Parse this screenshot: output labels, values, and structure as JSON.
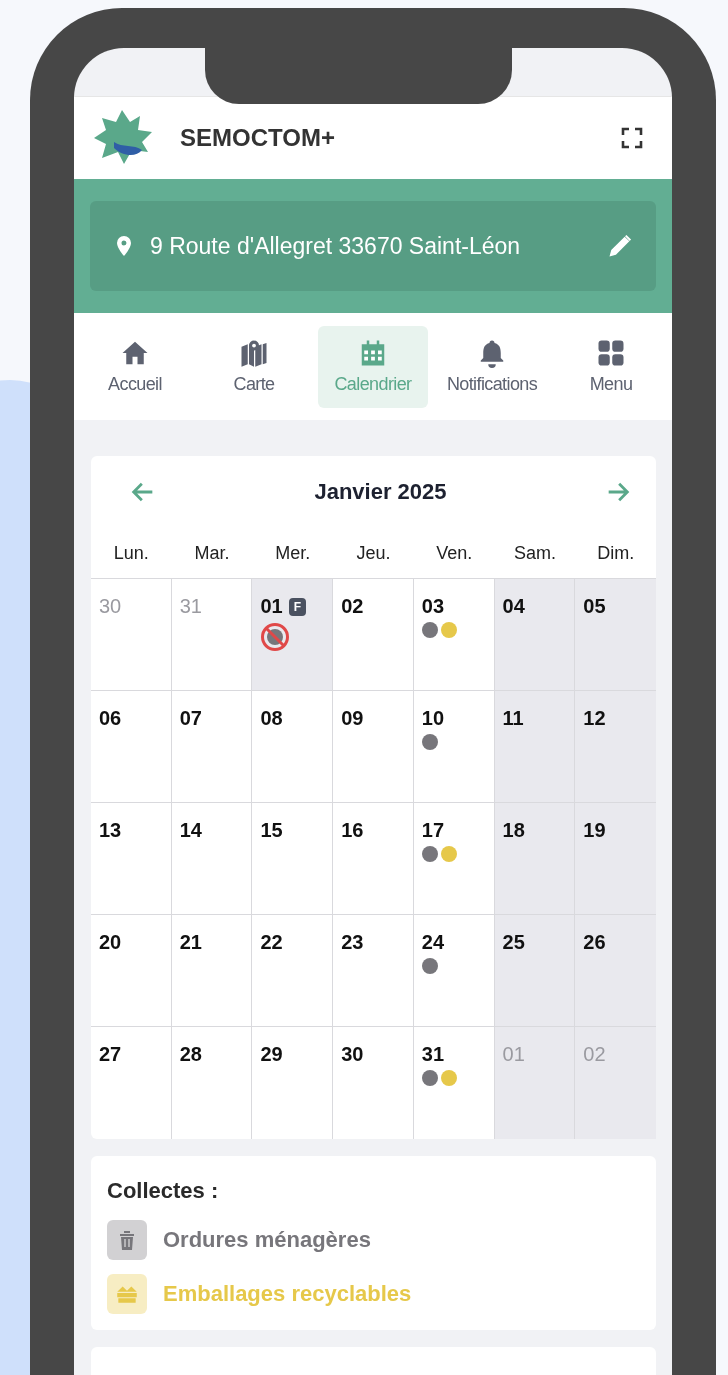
{
  "app_bar": {
    "title": "SEMOCTOM+"
  },
  "address": {
    "text": "9 Route d'Allegret 33670 Saint-Léon"
  },
  "nav": [
    {
      "label": "Accueil",
      "selected": false
    },
    {
      "label": "Carte",
      "selected": false
    },
    {
      "label": "Calendrier",
      "selected": true
    },
    {
      "label": "Notifications",
      "selected": false
    },
    {
      "label": "Menu",
      "selected": false
    }
  ],
  "calendar": {
    "month": "Janvier 2025",
    "weekdays": [
      {
        "label": "Lun.",
        "weekend": false
      },
      {
        "label": "Mar.",
        "weekend": false
      },
      {
        "label": "Mer.",
        "weekend": false
      },
      {
        "label": "Jeu.",
        "weekend": false
      },
      {
        "label": "Ven.",
        "weekend": false
      },
      {
        "label": "Sam.",
        "weekend": true
      },
      {
        "label": "Dim.",
        "weekend": true
      }
    ],
    "weeks": [
      [
        {
          "day": "30",
          "outside": true
        },
        {
          "day": "31",
          "outside": true
        },
        {
          "day": "01",
          "holiday": true,
          "badge": "F",
          "dots": [
            {
              "color": "#77767b",
              "cancelled": true
            }
          ]
        },
        {
          "day": "02"
        },
        {
          "day": "03",
          "dots": [
            {
              "color": "#77767b"
            },
            {
              "color": "#e6c84a"
            }
          ]
        },
        {
          "day": "04"
        },
        {
          "day": "05"
        }
      ],
      [
        {
          "day": "06"
        },
        {
          "day": "07"
        },
        {
          "day": "08"
        },
        {
          "day": "09"
        },
        {
          "day": "10",
          "dots": [
            {
              "color": "#77767b"
            }
          ]
        },
        {
          "day": "11"
        },
        {
          "day": "12"
        }
      ],
      [
        {
          "day": "13"
        },
        {
          "day": "14"
        },
        {
          "day": "15"
        },
        {
          "day": "16"
        },
        {
          "day": "17",
          "dots": [
            {
              "color": "#77767b"
            },
            {
              "color": "#e6c84a"
            }
          ]
        },
        {
          "day": "18"
        },
        {
          "day": "19"
        }
      ],
      [
        {
          "day": "20"
        },
        {
          "day": "21"
        },
        {
          "day": "22"
        },
        {
          "day": "23"
        },
        {
          "day": "24",
          "dots": [
            {
              "color": "#77767b"
            }
          ]
        },
        {
          "day": "25"
        },
        {
          "day": "26"
        }
      ],
      [
        {
          "day": "27"
        },
        {
          "day": "28"
        },
        {
          "day": "29"
        },
        {
          "day": "30"
        },
        {
          "day": "31",
          "dots": [
            {
              "color": "#77767b"
            },
            {
              "color": "#e6c84a"
            }
          ]
        },
        {
          "day": "01",
          "outside": true
        },
        {
          "day": "02",
          "outside": true
        }
      ]
    ]
  },
  "legend": {
    "title": "Collectes :",
    "items": [
      {
        "kind": "household",
        "label": "Ordures ménagères",
        "color": "#77767b"
      },
      {
        "kind": "recycling",
        "label": "Emballages recyclables",
        "color": "#e6c84a"
      }
    ]
  }
}
